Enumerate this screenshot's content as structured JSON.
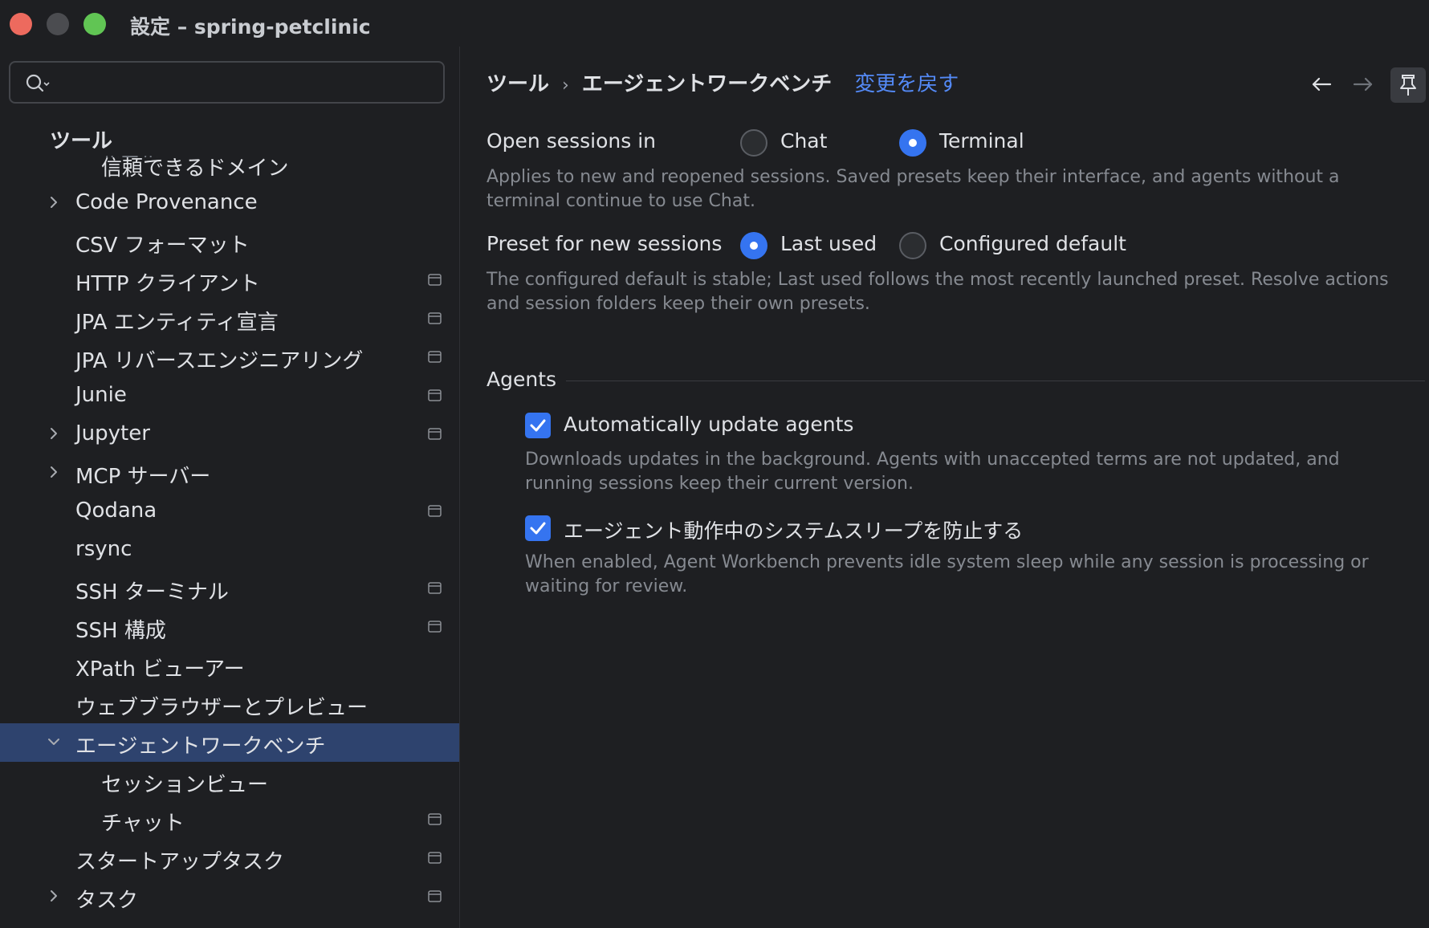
{
  "window": {
    "title": "設定 – spring-petclinic"
  },
  "search": {
    "placeholder": "",
    "value": ""
  },
  "sidebar": {
    "sticky_header": "ツール",
    "ghost_item": "ルール",
    "items": [
      {
        "label": "信頼できるドメイン",
        "level": 2,
        "chevron": "",
        "project_icon": false
      },
      {
        "label": "Code Provenance",
        "level": 1,
        "chevron": "right",
        "project_icon": false
      },
      {
        "label": "CSV フォーマット",
        "level": 1,
        "chevron": "",
        "project_icon": false
      },
      {
        "label": "HTTP クライアント",
        "level": 1,
        "chevron": "",
        "project_icon": true
      },
      {
        "label": "JPA エンティティ宣言",
        "level": 1,
        "chevron": "",
        "project_icon": true
      },
      {
        "label": "JPA リバースエンジニアリング",
        "level": 1,
        "chevron": "",
        "project_icon": true
      },
      {
        "label": "Junie",
        "level": 1,
        "chevron": "",
        "project_icon": true
      },
      {
        "label": "Jupyter",
        "level": 1,
        "chevron": "right",
        "project_icon": true
      },
      {
        "label": "MCP サーバー",
        "level": 1,
        "chevron": "right",
        "project_icon": false
      },
      {
        "label": "Qodana",
        "level": 1,
        "chevron": "",
        "project_icon": true
      },
      {
        "label": "rsync",
        "level": 1,
        "chevron": "",
        "project_icon": false
      },
      {
        "label": "SSH ターミナル",
        "level": 1,
        "chevron": "",
        "project_icon": true
      },
      {
        "label": "SSH 構成",
        "level": 1,
        "chevron": "",
        "project_icon": true
      },
      {
        "label": "XPath ビューアー",
        "level": 1,
        "chevron": "",
        "project_icon": false
      },
      {
        "label": "ウェブブラウザーとプレビュー",
        "level": 1,
        "chevron": "",
        "project_icon": false
      },
      {
        "label": "エージェントワークベンチ",
        "level": 1,
        "chevron": "down",
        "project_icon": false,
        "selected": true
      },
      {
        "label": "セッションビュー",
        "level": 2,
        "chevron": "",
        "project_icon": false
      },
      {
        "label": "チャット",
        "level": 2,
        "chevron": "",
        "project_icon": true
      },
      {
        "label": "スタートアップタスク",
        "level": 1,
        "chevron": "",
        "project_icon": true
      },
      {
        "label": "タスク",
        "level": 1,
        "chevron": "right",
        "project_icon": true
      }
    ]
  },
  "header": {
    "breadcrumb_parent": "ツール",
    "breadcrumb_separator": "›",
    "breadcrumb_current": "エージェントワークベンチ",
    "revert_link": "変更を戻す"
  },
  "settings": {
    "open_sessions": {
      "label": "Open sessions in",
      "option_chat": "Chat",
      "option_terminal": "Terminal",
      "selected": "Terminal",
      "help": "Applies to new and reopened sessions. Saved presets keep their interface, and agents without a terminal continue to use Chat."
    },
    "preset": {
      "label": "Preset for new sessions",
      "option_last_used": "Last used",
      "option_configured_default": "Configured default",
      "selected": "Last used",
      "help": "The configured default is stable; Last used follows the most recently launched preset. Resolve actions and session folders keep their own presets."
    },
    "agents_section": {
      "title": "Agents",
      "auto_update": {
        "label": "Automatically update agents",
        "checked": true,
        "help": "Downloads updates in the background. Agents with unaccepted terms are not updated, and running sessions keep their current version."
      },
      "prevent_sleep": {
        "label": "エージェント動作中のシステムスリープを防止する",
        "checked": true,
        "help": "When enabled, Agent Workbench prevents idle system sleep while any session is processing or waiting for review."
      }
    }
  },
  "colors": {
    "background": "#1e1f22",
    "selection": "#2e436e",
    "accent": "#3574f0",
    "link": "#548af7",
    "help_text": "#868a91"
  }
}
